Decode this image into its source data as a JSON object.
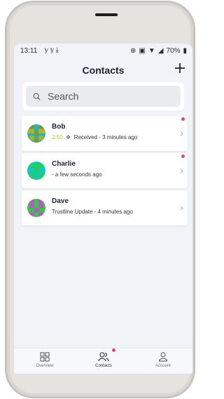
{
  "status_bar": {
    "time": "13:11",
    "notification_icons": [
      "twitter-icon",
      "twitter-icon",
      "download-icon"
    ],
    "right_icons": [
      "vibrate-icon",
      "nfc-icon",
      "wifi-icon",
      "signal-icon"
    ],
    "battery": "70%"
  },
  "header": {
    "title": "Contacts",
    "add_icon": "plus-icon"
  },
  "search": {
    "placeholder": "Search",
    "icon": "search-icon"
  },
  "contacts": [
    {
      "name": "Bob",
      "amount": "2.50",
      "amount_color": "#9acd32",
      "status_icon": "asset-icon",
      "status_text": "Received - 3 minutes ago",
      "unread": true
    },
    {
      "name": "Charlie",
      "status_text": " - a few seconds ago",
      "unread": true
    },
    {
      "name": "Dave",
      "status_text": "Trustline Update - 4 minutes ago",
      "unread": false
    }
  ],
  "tabs": [
    {
      "label": "Overview",
      "icon": "grid-icon",
      "active": false
    },
    {
      "label": "Contacts",
      "icon": "contacts-icon",
      "active": true,
      "badge": true
    },
    {
      "label": "Account",
      "icon": "person-icon",
      "active": false
    }
  ],
  "colors": {
    "badge": "#e0457b",
    "amount": "#9acd32",
    "background": "#f0f4f8"
  }
}
